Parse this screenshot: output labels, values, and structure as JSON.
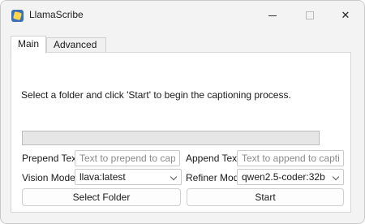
{
  "window": {
    "title": "LlamaScribe"
  },
  "tabs": [
    {
      "label": "Main"
    },
    {
      "label": "Advanced"
    }
  ],
  "main": {
    "instructions": "Select a folder and click 'Start' to begin the captioning process.",
    "progress_fraction": 0,
    "prepend": {
      "label": "Prepend Text:",
      "placeholder": "Text to prepend to captions",
      "value": ""
    },
    "append": {
      "label": "Append Text:",
      "placeholder": "Text to append to captions",
      "value": ""
    },
    "vision_model": {
      "label": "Vision Model:",
      "value": "llava:latest"
    },
    "refiner_model": {
      "label": "Refiner Model:",
      "value": "qwen2.5-coder:32b"
    },
    "select_folder_label": "Select Folder",
    "start_label": "Start"
  },
  "colors": {
    "progress_fill": "#06b025",
    "window_bg": "#f3f3f3"
  }
}
